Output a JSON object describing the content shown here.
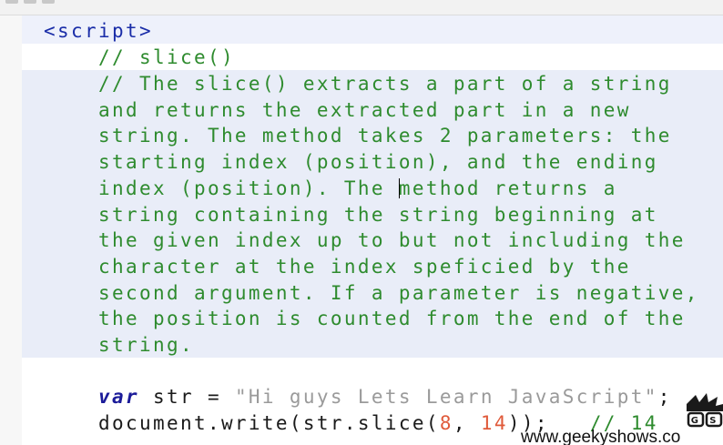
{
  "code": {
    "script_tag": "<script>",
    "comment_title": "// slice()",
    "comment_lines": [
      "// The slice() extracts a part of a string",
      "and returns the extracted part in a new",
      "string. The method takes 2 parameters: the",
      "starting index (position), and the ending",
      "index (position). The ",
      "method returns a",
      "string containing the string beginning at",
      "the given index up to but not including the",
      "character at the index speficied by the",
      "second argument. If a parameter is negative,",
      "the position is counted from the end of the",
      "string."
    ],
    "var_line": {
      "keyword": "var",
      "rest": " str = ",
      "string_value": "\"Hi guys Lets Learn JavaScript\"",
      "end": ";"
    },
    "write_line": {
      "call": "document.write(str.slice(",
      "arg1": "8",
      "sep": ", ",
      "arg2": "14",
      "close": "));",
      "comment": "// 14"
    }
  },
  "watermark": {
    "text": "www.geekyshows.co",
    "icon": "geekyshows-logo-icon"
  }
}
